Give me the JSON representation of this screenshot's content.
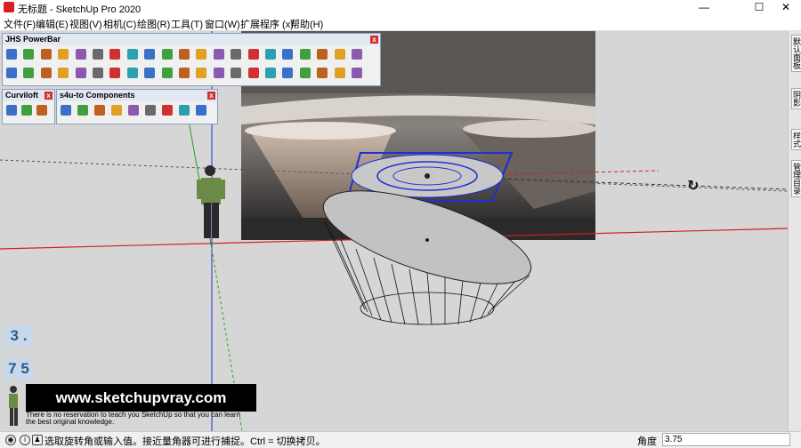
{
  "window": {
    "title": "无标题 - SketchUp Pro 2020",
    "minimize": "—",
    "maximize": "☐",
    "close": "✕"
  },
  "menu": [
    "文件(F)",
    "编辑(E)",
    "视图(V)",
    "相机(C)",
    "绘图(R)",
    "工具(T)",
    "窗口(W)",
    "扩展程序 (x)",
    "帮助(H)"
  ],
  "toolbars": {
    "powerbar": {
      "title": "JHS PowerBar"
    },
    "curviloft": {
      "title": "Curviloft"
    },
    "s4u": {
      "title": "s4u-to Components"
    }
  },
  "right_tabs": [
    "默认面板",
    "阴影",
    "样式",
    "管理目录"
  ],
  "badges": {
    "b1": "3 .",
    "b2": "7 5"
  },
  "watermark": {
    "url": "www.sketchupvray.com",
    "line1": "There is no reservation to teach you SketchUp so that you can learn",
    "line2": "the best original knowledge."
  },
  "status": {
    "text": "选取旋转角或输入值。接近量角器可进行捕捉。Ctrl = 切换拷贝。",
    "measure_label": "角度",
    "measure_value": "3.75"
  },
  "colors": {
    "red_axis": "#d02020",
    "green_axis": "#20a020",
    "blue_axis": "#2030d0",
    "selection": "#1e2fd6"
  },
  "icons": [
    "sketchup-app-icon",
    "geo-location-icon",
    "info-icon",
    "user-icon",
    "rotate-cursor-icon",
    "close-icon"
  ]
}
